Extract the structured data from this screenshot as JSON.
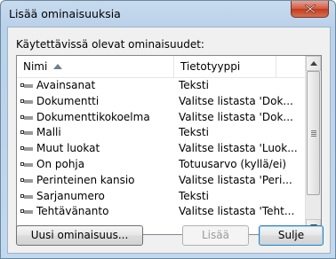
{
  "window": {
    "title": "Lisää ominaisuuksia"
  },
  "list": {
    "label": "Käytettävissä olevat ominaisuudet:",
    "columns": {
      "name": "Nimi",
      "type": "Tietotyyppi"
    },
    "sort_column": "name",
    "items": [
      {
        "name": "Avainsanat",
        "type": "Teksti"
      },
      {
        "name": "Dokumentti",
        "type": "Valitse listasta 'Dok..."
      },
      {
        "name": "Dokumenttikokoelma",
        "type": "Valitse listasta 'Dok..."
      },
      {
        "name": "Malli",
        "type": "Teksti"
      },
      {
        "name": "Muut luokat",
        "type": "Valitse listasta 'Luok..."
      },
      {
        "name": "On pohja",
        "type": "Totuusarvo (kyllä/ei)"
      },
      {
        "name": "Perinteinen kansio",
        "type": "Valitse listasta 'Peri..."
      },
      {
        "name": "Sarjanumero",
        "type": "Teksti"
      },
      {
        "name": "Tehtävänanto",
        "type": "Valitse listasta 'Teht..."
      }
    ]
  },
  "buttons": {
    "new_property": "Uusi ominaisuus...",
    "add": "Lisää",
    "close": "Sulje"
  },
  "icons": {
    "item_icon": "property-icon",
    "close": "close-icon"
  }
}
